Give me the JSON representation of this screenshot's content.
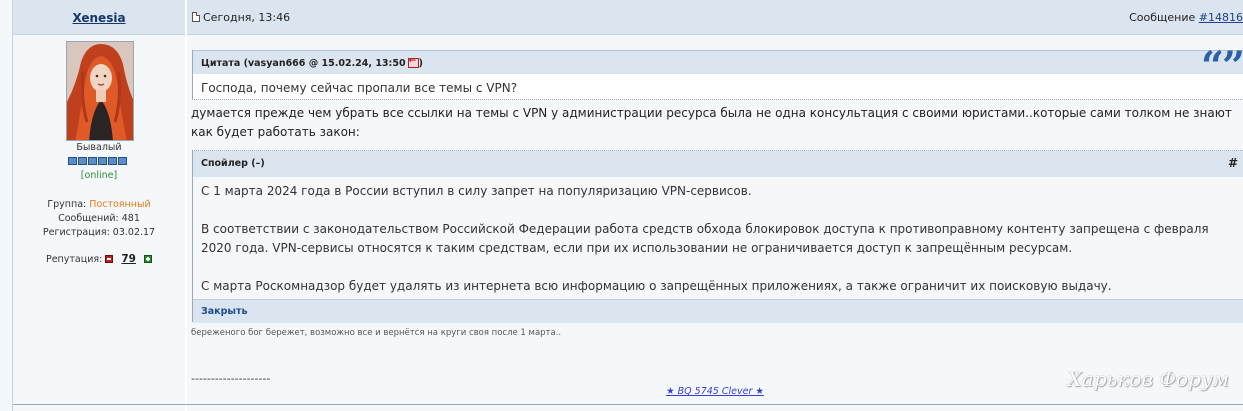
{
  "user": {
    "name": "Xenesia",
    "rank": "Бывалый",
    "rank_pips": 6,
    "status": "[online]",
    "group_label": "Группа:",
    "group_value": "Постоянный",
    "posts": "Сообщений: 481",
    "registered": "Регистрация: 03.02.17",
    "reputation_label": "Репутация:",
    "reputation_value": "79"
  },
  "post": {
    "date": "Сегодня, 13:46",
    "message_label": "Сообщение ",
    "message_number": "#14816",
    "quote": {
      "title": "Цитата (vasyan666 @ 15.02.24, 13:50",
      "close_paren": ")",
      "text": "Господа, почему сейчас пропали все темы с VPN?"
    },
    "text": "думается прежде чем убрать все ссылки на темы с VPN у администрации ресурса была не одна консультация с своими юристами..которые сами толком не знают как будет работать закон:",
    "spoiler": {
      "title": "Спойлер (–)",
      "hash": "#",
      "paragraphs": [
        "С 1 марта 2024 года в России вступил в силу запрет на популяризацию VPN-сервисов.",
        "В соответствии с законодательством Российской Федерации работа средств обхода блокировок доступа к противоправному контенту запрещена с февраля 2020 года. VPN-сервисы относятся к таким средствам, если при их использовании не ограничивается доступ к запрещённым ресурсам.",
        "С марта Роскомнадзор будет удалять из интернета всю информацию о запрещённых приложениях, а также ограничит их поисковую выдачу."
      ],
      "close_label": "Закрыть"
    },
    "signature": "береженого бог бережет, возможно все и вернётся на круги своя после 1 марта..",
    "separator": "--------------------",
    "device": "★ BQ 5745 Clever ★",
    "watermark": "Харьков Форум"
  },
  "colors": {
    "header_bg": "#dbe5f0",
    "link": "#1e3f8a",
    "group": "#e07b1c",
    "online": "#2e8b2e"
  }
}
